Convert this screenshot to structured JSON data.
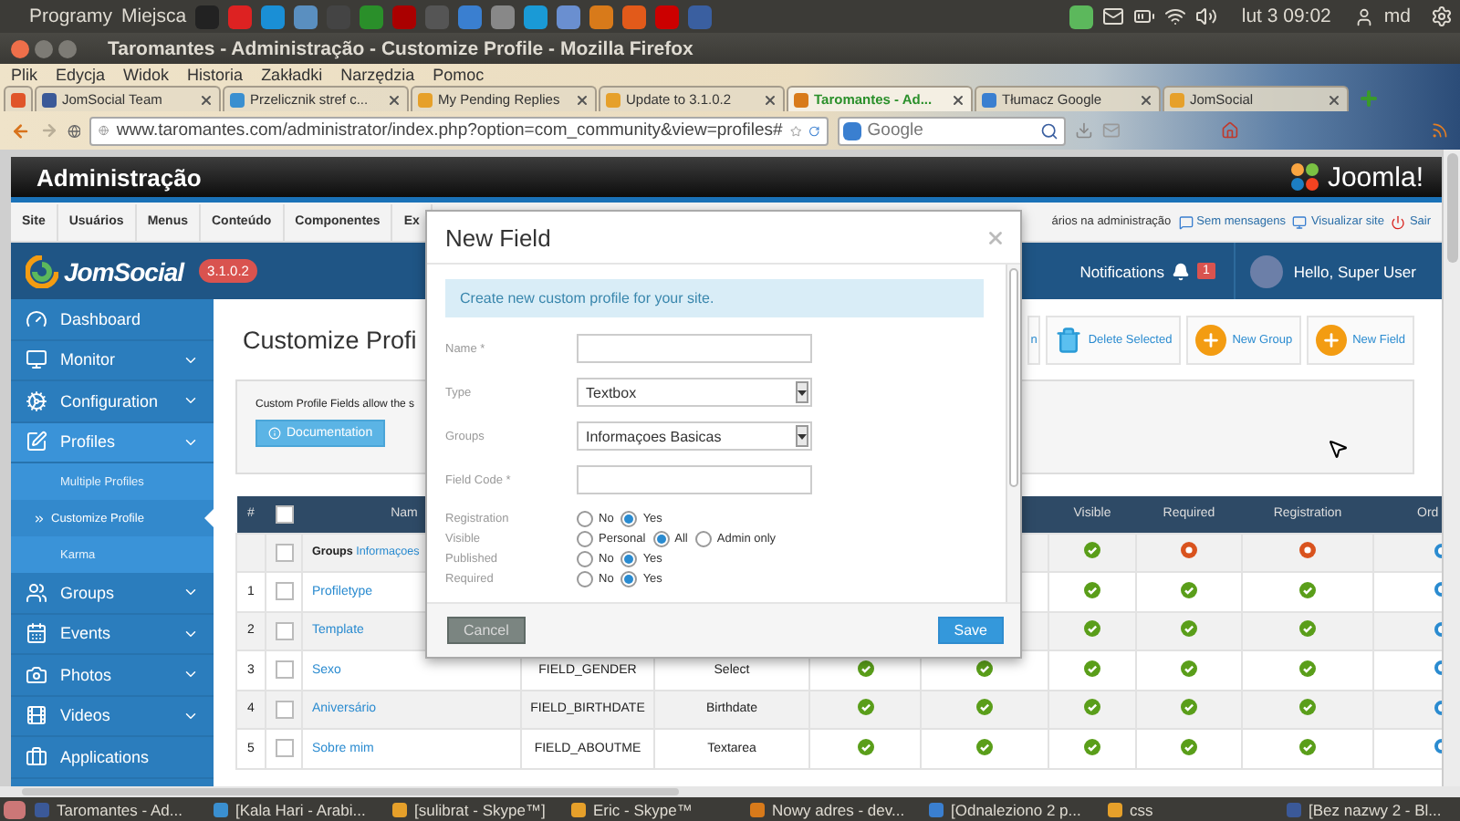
{
  "top_panel": {
    "menus": [
      "Programy",
      "Miejsca"
    ],
    "clock": "lut 3 09:02",
    "user": "md"
  },
  "window": {
    "title": "Taromantes - Administração - Customize Profile - Mozilla Firefox"
  },
  "browser": {
    "menu": [
      "Plik",
      "Edycja",
      "Widok",
      "Historia",
      "Zakładki",
      "Narzędzia",
      "Pomoc"
    ],
    "tabs": [
      {
        "label": "JomSocial Team",
        "selected": false
      },
      {
        "label": "Przelicznik stref c...",
        "selected": false
      },
      {
        "label": "My Pending Replies",
        "selected": false
      },
      {
        "label": "Update to 3.1.0.2",
        "selected": false
      },
      {
        "label": "Taromantes - Ad...",
        "selected": true
      },
      {
        "label": "Tłumacz Google",
        "selected": false
      },
      {
        "label": "JomSocial",
        "selected": false
      }
    ],
    "url": "www.taromantes.com/administrator/index.php?option=com_community&view=profiles#",
    "search": {
      "placeholder": "Google"
    }
  },
  "admin": {
    "title": "Administração",
    "brand": "Joomla!",
    "menu": [
      "Site",
      "Usuários",
      "Menus",
      "Conteúdo",
      "Componentes",
      "Ex"
    ],
    "status": [
      "ários na administração",
      "Sem mensagens",
      "Visualizar site",
      "Sair"
    ]
  },
  "jomsocial": {
    "logo": "JomSocial",
    "version": "3.1.0.2",
    "notifications": "Notifications",
    "count": "1",
    "greeting": "Hello, Super User"
  },
  "sidebar": {
    "items": [
      {
        "label": "Dashboard"
      },
      {
        "label": "Monitor",
        "expanded": false
      },
      {
        "label": "Configuration",
        "expanded": false
      },
      {
        "label": "Profiles",
        "expanded": true,
        "children": [
          {
            "label": "Multiple Profiles",
            "selected": false
          },
          {
            "label": "Customize Profile",
            "selected": true
          },
          {
            "label": "Karma",
            "selected": false
          }
        ]
      },
      {
        "label": "Groups",
        "expanded": false
      },
      {
        "label": "Events",
        "expanded": false
      },
      {
        "label": "Photos",
        "expanded": false
      },
      {
        "label": "Videos",
        "expanded": false
      },
      {
        "label": "Applications"
      }
    ]
  },
  "page": {
    "title": "Customize Profi",
    "toolbar": [
      {
        "kind": "plain",
        "label": "n"
      },
      {
        "kind": "delete",
        "label": "Delete Selected"
      },
      {
        "kind": "add",
        "label": "New Group"
      },
      {
        "kind": "add",
        "label": "New Field"
      }
    ],
    "intro": "Custom Profile Fields allow the s",
    "documentation": "Documentation"
  },
  "table": {
    "columns": [
      "#",
      "Nam",
      "Visible",
      "Required",
      "Registration",
      "Ord"
    ],
    "select_all": {
      "checked": false
    },
    "rows": [
      {
        "kind": "group",
        "label": "Groups",
        "name": "Informaçoes",
        "checked": false,
        "flags": {
          "visible": true,
          "required": false,
          "registration": false
        }
      },
      {
        "kind": "field",
        "number": "1",
        "name": "Profiletype",
        "checked": false,
        "flags": {
          "visible": true,
          "required": true,
          "registration": true
        }
      },
      {
        "kind": "field",
        "number": "2",
        "name": "Template",
        "checked": false,
        "flags": {
          "visible": true,
          "required": true,
          "registration": true
        }
      },
      {
        "kind": "field",
        "number": "3",
        "name": "Sexo",
        "code": "FIELD_GENDER",
        "type": "Select",
        "checked": false,
        "flags": {
          "column_6": true,
          "column_7": true,
          "visible": true,
          "required": true,
          "registration": true
        }
      },
      {
        "kind": "field",
        "number": "4",
        "name": "Aniversário",
        "code": "FIELD_BIRTHDATE",
        "type": "Birthdate",
        "checked": false,
        "flags": {
          "column_6": true,
          "column_7": true,
          "visible": true,
          "required": true,
          "registration": true
        }
      },
      {
        "kind": "field",
        "number": "5",
        "name": "Sobre mim",
        "code": "FIELD_ABOUTME",
        "type": "Textarea",
        "checked": false,
        "flags": {
          "column_6": true,
          "column_7": true,
          "visible": true,
          "required": true,
          "registration": true
        }
      }
    ]
  },
  "modal": {
    "title": "New Field",
    "alert": "Create new custom profile for your site.",
    "fields": [
      {
        "kind": "text",
        "label": "Name *"
      },
      {
        "kind": "select",
        "label": "Type",
        "value": "Textbox"
      },
      {
        "kind": "select",
        "label": "Groups",
        "value": "Informaçoes Basicas"
      },
      {
        "kind": "text",
        "label": "Field Code *"
      },
      {
        "kind": "radio",
        "label": "Registration",
        "options": [
          {
            "label": "No",
            "selected": false
          },
          {
            "label": "Yes",
            "selected": true
          }
        ]
      },
      {
        "kind": "radio",
        "label": "Visible",
        "options": [
          {
            "label": "Personal",
            "selected": false
          },
          {
            "label": "All",
            "selected": true
          },
          {
            "label": "Admin only",
            "selected": false
          }
        ]
      },
      {
        "kind": "radio",
        "label": "Published",
        "options": [
          {
            "label": "No",
            "selected": false
          },
          {
            "label": "Yes",
            "selected": true
          }
        ]
      },
      {
        "kind": "radio",
        "label": "Required",
        "options": [
          {
            "label": "No",
            "selected": false
          },
          {
            "label": "Yes",
            "selected": true
          }
        ]
      }
    ],
    "buttons": [
      {
        "kind": "secondary",
        "label": "Cancel"
      },
      {
        "kind": "primary",
        "label": "Save"
      }
    ]
  },
  "taskbar": [
    "Taromantes - Ad...",
    "[Kala Hari - Arabi...",
    "[sulibrat - Skype™]",
    "Eric - Skype™",
    "Nowy adres - dev...",
    "[Odnaleziono 2 p...",
    "css",
    "[Bez nazwy 2 - Bl..."
  ]
}
